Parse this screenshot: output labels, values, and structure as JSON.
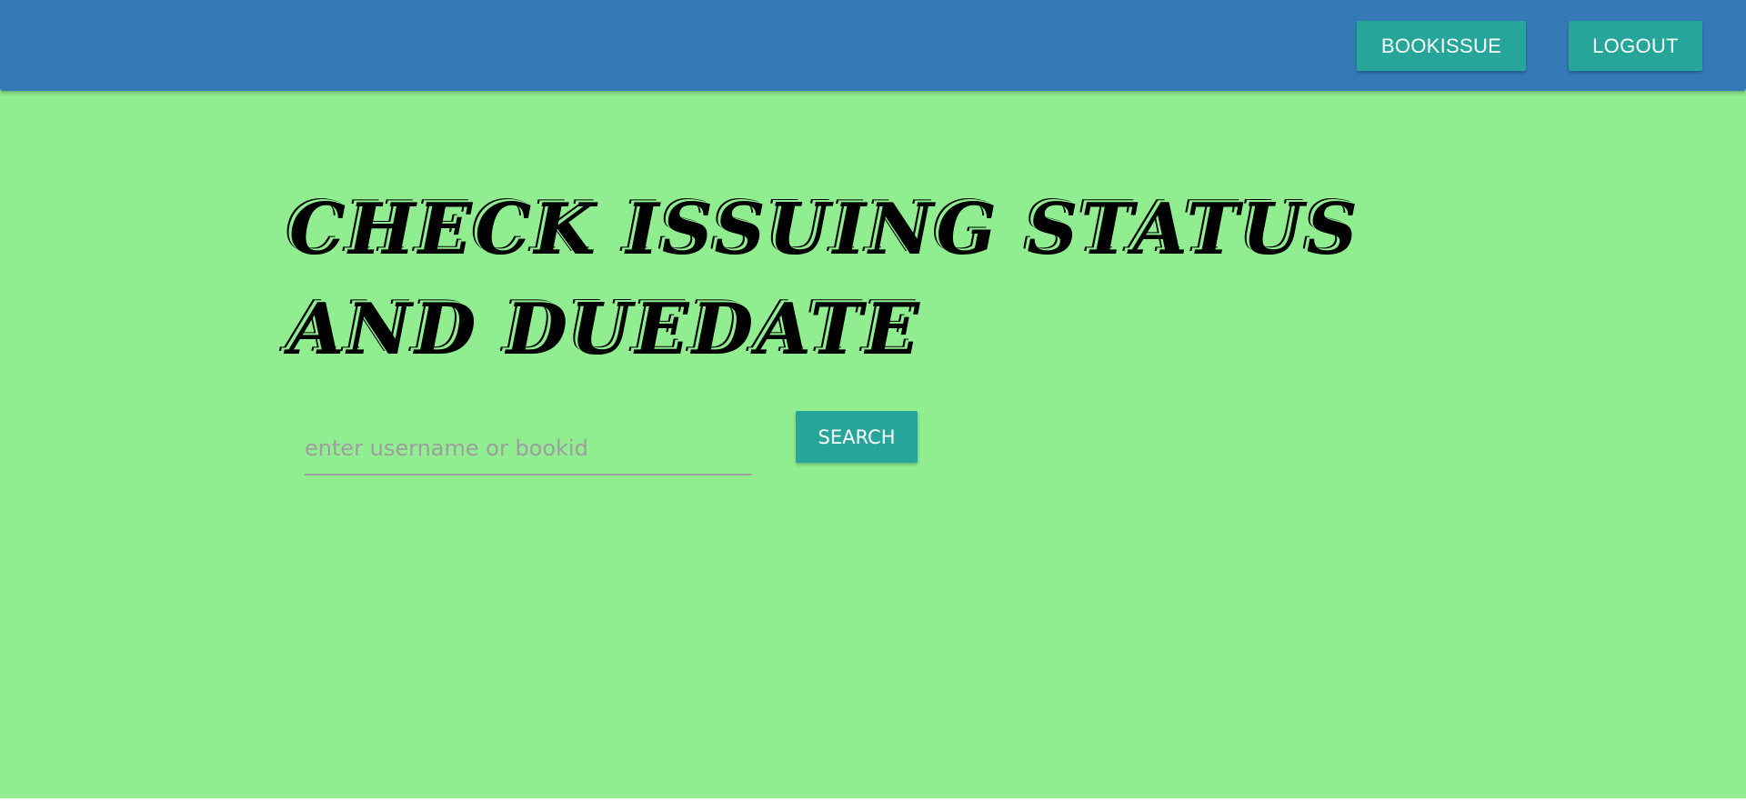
{
  "navbar": {
    "bookissue_label": "BOOKISSUE",
    "logout_label": "LOGOUT"
  },
  "main": {
    "title": "CHECK ISSUING STATUS AND DUEDATE",
    "search": {
      "placeholder": "enter username or bookid",
      "value": "",
      "button_label": "SEARCH"
    }
  },
  "colors": {
    "navbar": "#337ab7",
    "button": "#26a69a",
    "background": "#90ee90"
  }
}
